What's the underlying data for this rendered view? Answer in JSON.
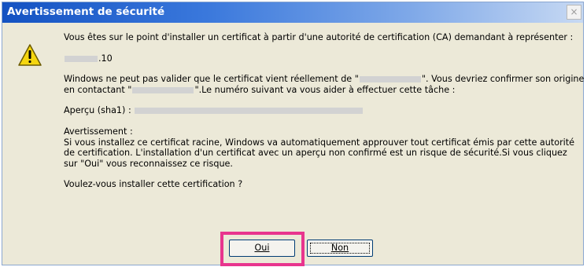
{
  "dialog": {
    "title": "Avertissement de sécurité",
    "close_glyph": "×",
    "icon": "warning-icon",
    "accent_color": "#e8358e",
    "intro": "Vous êtes sur le point d'installer un certificat à partir d'une autorité de certification (CA) demandant à représenter :",
    "host_suffix": ".10",
    "validate_part1": "Windows ne peut pas valider que le certificat vient réellement de \"",
    "validate_part2": "\". Vous devriez confirmer son origine",
    "validate_line2_part1": "en contactant \"",
    "validate_line2_part2": "\".Le numéro suivant va vous aider à effectuer cette tâche :",
    "thumbprint_label": "Aperçu (sha1) :",
    "warning_heading": "Avertissement :",
    "warning_body": "Si vous installez ce certificat racine, Windows va automatiquement approuver tout certificat émis par cette autorité de certification. L'installation d'un certificat avec un aperçu non confirmé est un risque de sécurité.Si vous cliquez sur \"Oui\" vous reconnaissez ce risque.",
    "question": "Voulez-vous installer cette certification ?",
    "buttons": {
      "yes": "Oui",
      "no": "Non"
    }
  }
}
